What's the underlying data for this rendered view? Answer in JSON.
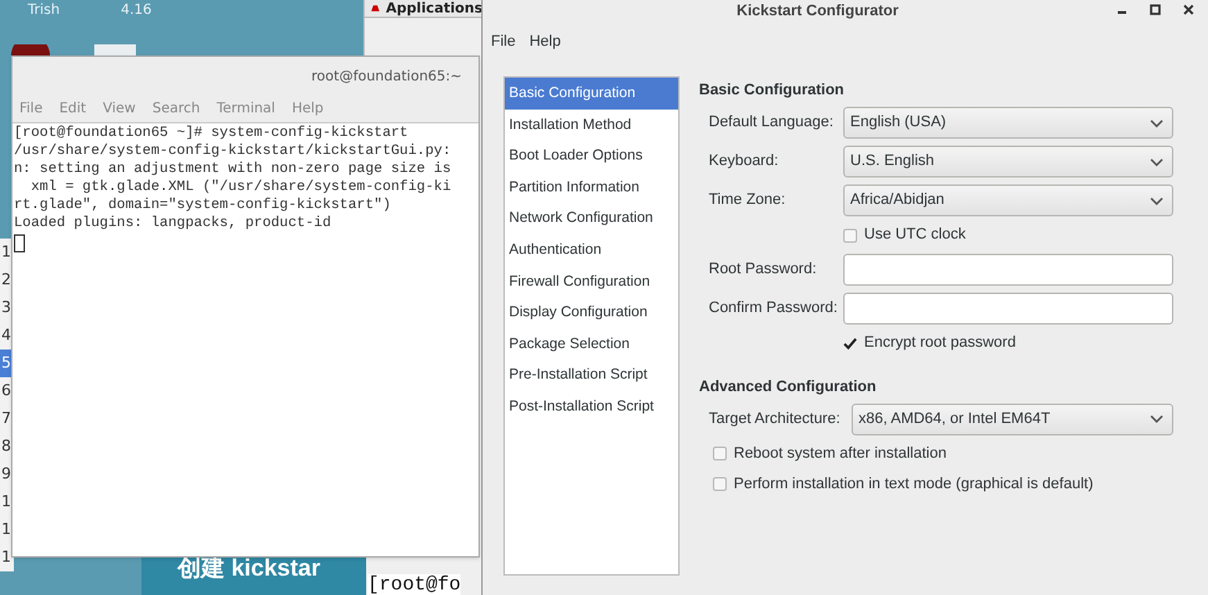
{
  "desktop": {
    "top_labels": [
      "Trish",
      "4.16"
    ],
    "line_numbers": [
      {
        "label": "1",
        "selected": false
      },
      {
        "label": "2",
        "selected": false
      },
      {
        "label": "3",
        "selected": false
      },
      {
        "label": "4",
        "selected": false
      },
      {
        "label": "5",
        "selected": true
      },
      {
        "label": "6",
        "selected": false
      },
      {
        "label": "7",
        "selected": false
      },
      {
        "label": "8",
        "selected": false
      },
      {
        "label": "9",
        "selected": false
      },
      {
        "label": "1",
        "selected": false
      },
      {
        "label": "1",
        "selected": false
      },
      {
        "label": "1",
        "selected": false
      }
    ],
    "banner": "创建 kickstar",
    "panel_menu": "Applications",
    "back_terminal_text": "[root@fo"
  },
  "terminal": {
    "title": "root@foundation65:~",
    "menu": [
      "File",
      "Edit",
      "View",
      "Search",
      "Terminal",
      "Help"
    ],
    "lines": [
      "[root@foundation65 ~]# system-config-kickstart",
      "/usr/share/system-config-kickstart/kickstartGui.py:",
      "n: setting an adjustment with non-zero page size is",
      "  xml = gtk.glade.XML (\"/usr/share/system-config-ki",
      "rt.glade\", domain=\"system-config-kickstart\")",
      "Loaded plugins: langpacks, product-id"
    ]
  },
  "window": {
    "title": "Kickstart Configurator",
    "menu": [
      "File",
      "Help"
    ],
    "sidebar": {
      "items": [
        {
          "label": "Basic Configuration",
          "selected": true
        },
        {
          "label": "Installation Method",
          "selected": false
        },
        {
          "label": "Boot Loader Options",
          "selected": false
        },
        {
          "label": "Partition Information",
          "selected": false
        },
        {
          "label": "Network Configuration",
          "selected": false
        },
        {
          "label": "Authentication",
          "selected": false
        },
        {
          "label": "Firewall Configuration",
          "selected": false
        },
        {
          "label": "Display Configuration",
          "selected": false
        },
        {
          "label": "Package Selection",
          "selected": false
        },
        {
          "label": "Pre-Installation Script",
          "selected": false
        },
        {
          "label": "Post-Installation Script",
          "selected": false
        }
      ]
    },
    "basic": {
      "heading": "Basic Configuration",
      "rows": [
        {
          "kind": "select",
          "label": "Default Language:",
          "value": "English (USA)"
        },
        {
          "kind": "select",
          "label": "Keyboard:",
          "value": "U.S. English"
        },
        {
          "kind": "select",
          "label": "Time Zone:",
          "value": "Africa/Abidjan"
        },
        {
          "kind": "checkbox",
          "label": "Use UTC clock",
          "checked": false
        },
        {
          "kind": "password",
          "label": "Root Password:"
        },
        {
          "kind": "password",
          "label": "Confirm Password:"
        },
        {
          "kind": "checkbox",
          "label": "Encrypt root password",
          "checked": true
        }
      ]
    },
    "advanced": {
      "heading": "Advanced Configuration",
      "rows": [
        {
          "kind": "select",
          "label": "Target Architecture:",
          "value": "x86, AMD64, or Intel EM64T"
        },
        {
          "kind": "checkbox",
          "label": "Reboot system after installation",
          "checked": false
        },
        {
          "kind": "checkbox",
          "label": "Perform installation in text mode (graphical is default)",
          "checked": false
        }
      ]
    }
  }
}
